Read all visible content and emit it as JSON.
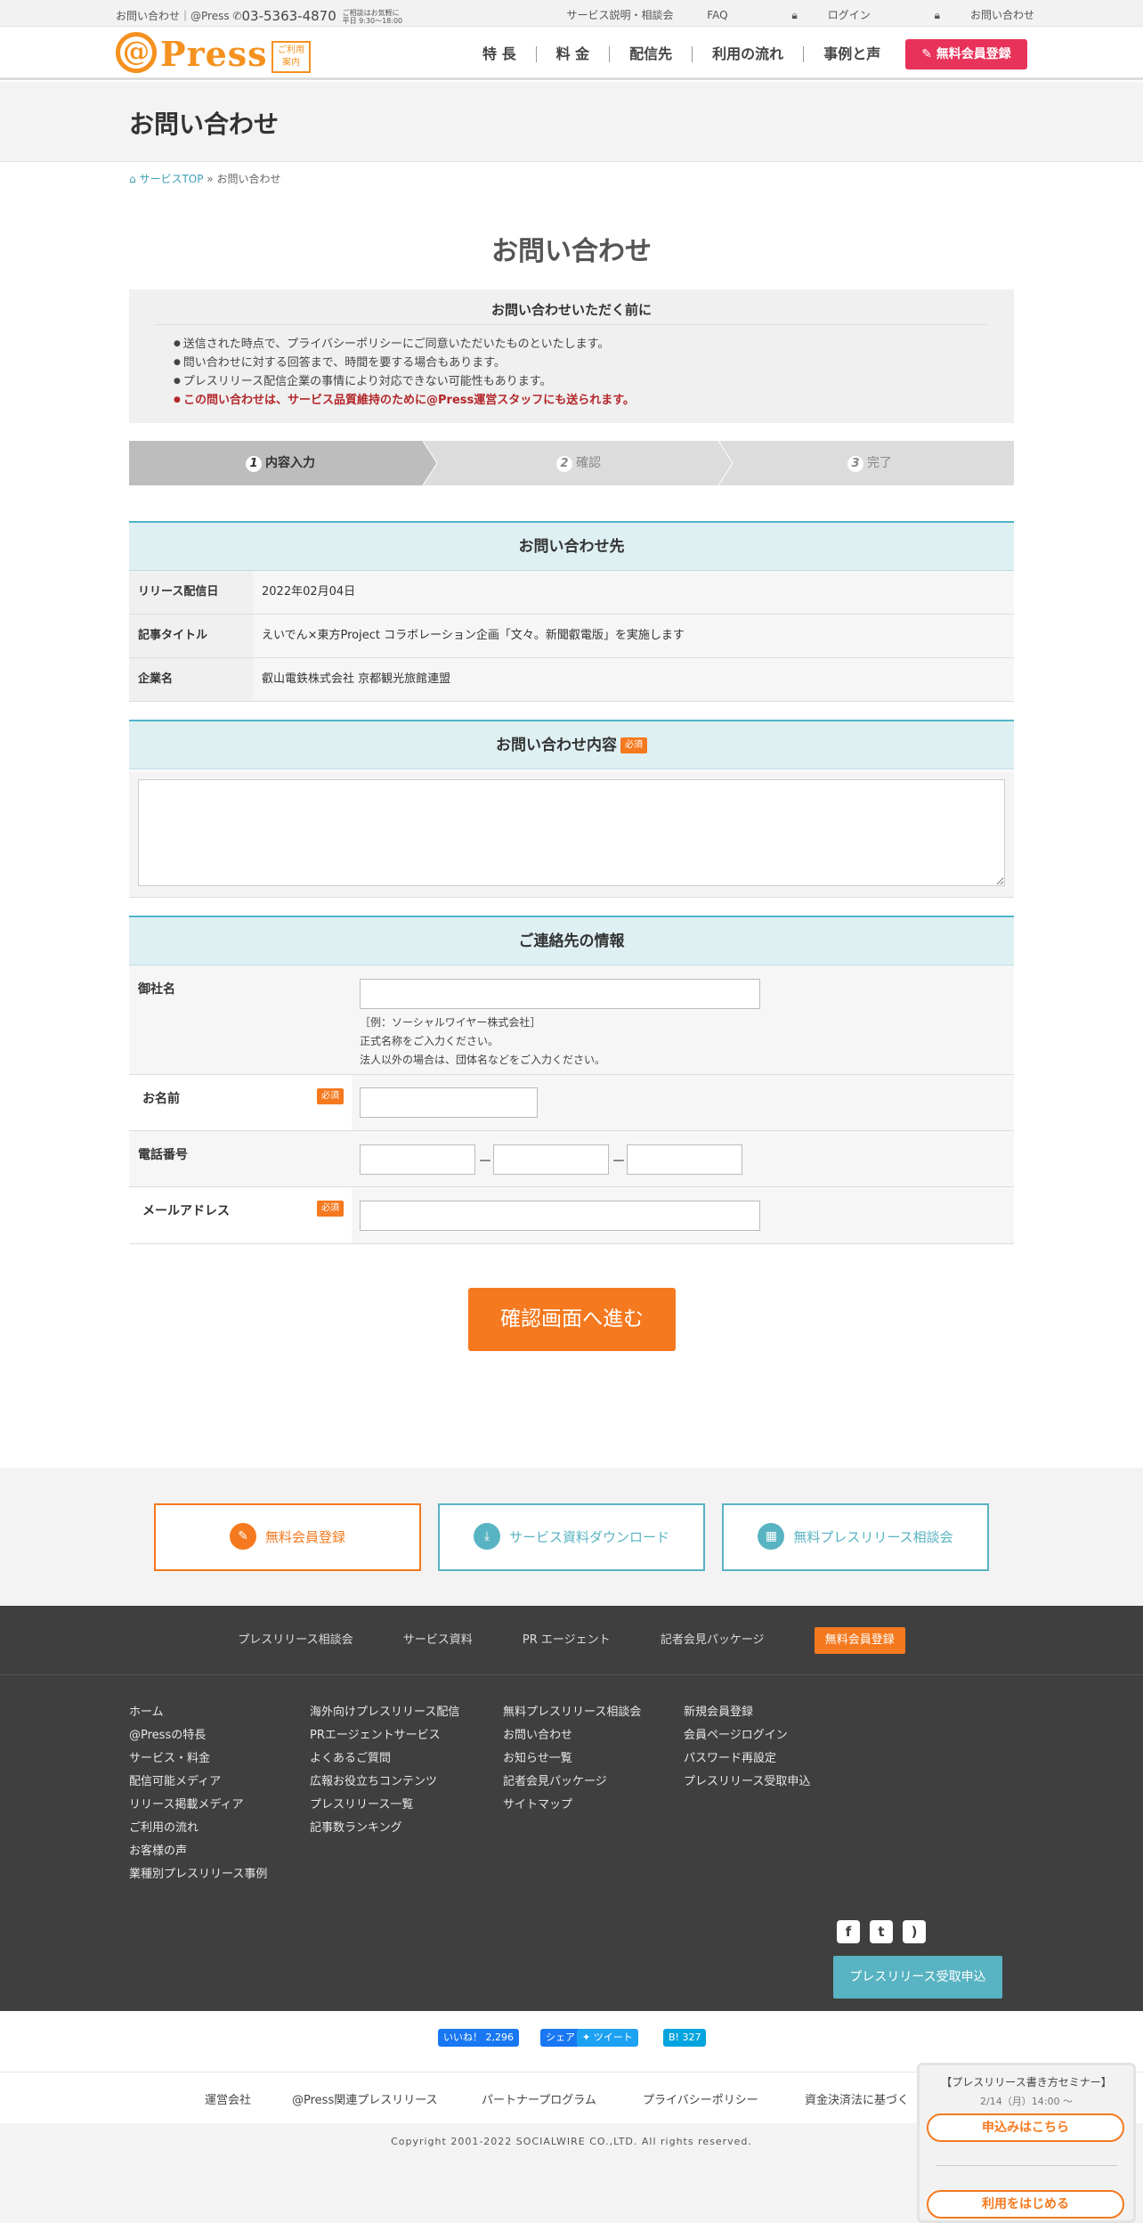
{
  "topbar": {
    "left_text": "お問い合わせ｜@Press",
    "tel": "03-5363-4870",
    "hours_line1": "ご相談はお気軽に",
    "hours_line2": "平日 9:30～18:00",
    "links": [
      "サービス説明・相談会",
      "FAQ",
      "ログイン",
      "お問い合わせ"
    ]
  },
  "header": {
    "logo_text": "Press",
    "logo_badge_line1": "ご利用",
    "logo_badge_line2": "案内",
    "nav": [
      "特 長",
      "料 金",
      "配信先",
      "利用の流れ",
      "事例と声"
    ],
    "signup_label": "無料会員登録"
  },
  "page": {
    "head_title": "お問い合わせ",
    "breadcrumb": {
      "home": "サービスTOP",
      "sep": "»",
      "current": "お問い合わせ"
    },
    "main_title": "お問い合わせ"
  },
  "notice": {
    "title": "お問い合わせいただく前に",
    "items": [
      "送信された時点で、プライバシーポリシーにご同意いただいたものといたします。",
      "問い合わせに対する回答まで、時間を要する場合もあります。",
      "プレスリリース配信企業の事情により対応できない可能性もあります。",
      "この問い合わせは、サービス品質維持のために@Press運営スタッフにも送られます。"
    ]
  },
  "steps": [
    {
      "num": "1",
      "label": "内容入力"
    },
    {
      "num": "2",
      "label": "確認"
    },
    {
      "num": "3",
      "label": "完了"
    }
  ],
  "contact_to": {
    "heading": "お問い合わせ先",
    "rows": [
      {
        "label": "リリース配信日",
        "value": "2022年02月04日"
      },
      {
        "label": "記事タイトル",
        "value": "えいでん×東方Project コラボレーション企画「文々。新聞叡電版」を実施します"
      },
      {
        "label": "企業名",
        "value": "叡山電鉄株式会社 京都観光旅館連盟"
      }
    ]
  },
  "inquiry": {
    "heading": "お問い合わせ内容",
    "required": "必須",
    "value": ""
  },
  "contact_info": {
    "heading": "ご連絡先の情報",
    "company_label": "御社名",
    "company_hint": [
      "［例：ソーシャルワイヤー株式会社］",
      "正式名称をご入力ください。",
      "法人以外の場合は、団体名などをご入力ください。"
    ],
    "name_label": "お名前",
    "phone_label": "電話番号",
    "phone_sep": "－",
    "email_label": "メールアドレス",
    "required": "必須"
  },
  "submit_label": "確認画面へ進む",
  "cta": [
    {
      "label": "無料会員登録",
      "color": "#f5791f"
    },
    {
      "label": "サービス資料ダウンロード",
      "color": "#58b3c2"
    },
    {
      "label": "無料プレスリリース相談会",
      "color": "#58b3c2"
    }
  ],
  "footer": {
    "nav": [
      "プレスリリース相談会",
      "サービス資料",
      "PR エージェント",
      "記者会見パッケージ",
      "無料会員登録"
    ],
    "col1": [
      "ホーム",
      "@Pressの特長",
      "サービス・料金",
      "配信可能メディア",
      "リリース掲載メディア",
      "ご利用の流れ",
      "お客様の声",
      "業種別プレスリリース事例"
    ],
    "col2": [
      "海外向けプレスリリース配信",
      "PRエージェントサービス",
      "よくあるご質問",
      "広報お役立ちコンテンツ",
      "プレスリリース一覧",
      "記事数ランキング"
    ],
    "col3": [
      "無料プレスリリース相談会",
      "お問い合わせ",
      "お知らせ一覧",
      "記者会見パッケージ",
      "サイトマップ"
    ],
    "col4": [
      "新規会員登録",
      "会員ページログイン",
      "パスワード再設定",
      "プレスリリース受取申込"
    ],
    "press_button": "プレスリリース受取申込"
  },
  "share": {
    "like": "いいね！ 2,296",
    "share": "シェア",
    "tweet": "ツイート",
    "hatena": "B! 327"
  },
  "bottom_links": [
    "運営会社",
    "@Press関連プレスリリース",
    "パートナープログラム",
    "プライバシーポリシー",
    "資金決済法に基づく"
  ],
  "copyright": "Copyright 2001-2022 SOCIALWIRE CO.,LTD. All rights reserved.",
  "float": {
    "title": "【プレスリリース書き方セミナー】",
    "date": "2/14（月）14:00 ～",
    "apply": "申込みはこちら",
    "start": "利用をはじめる"
  }
}
